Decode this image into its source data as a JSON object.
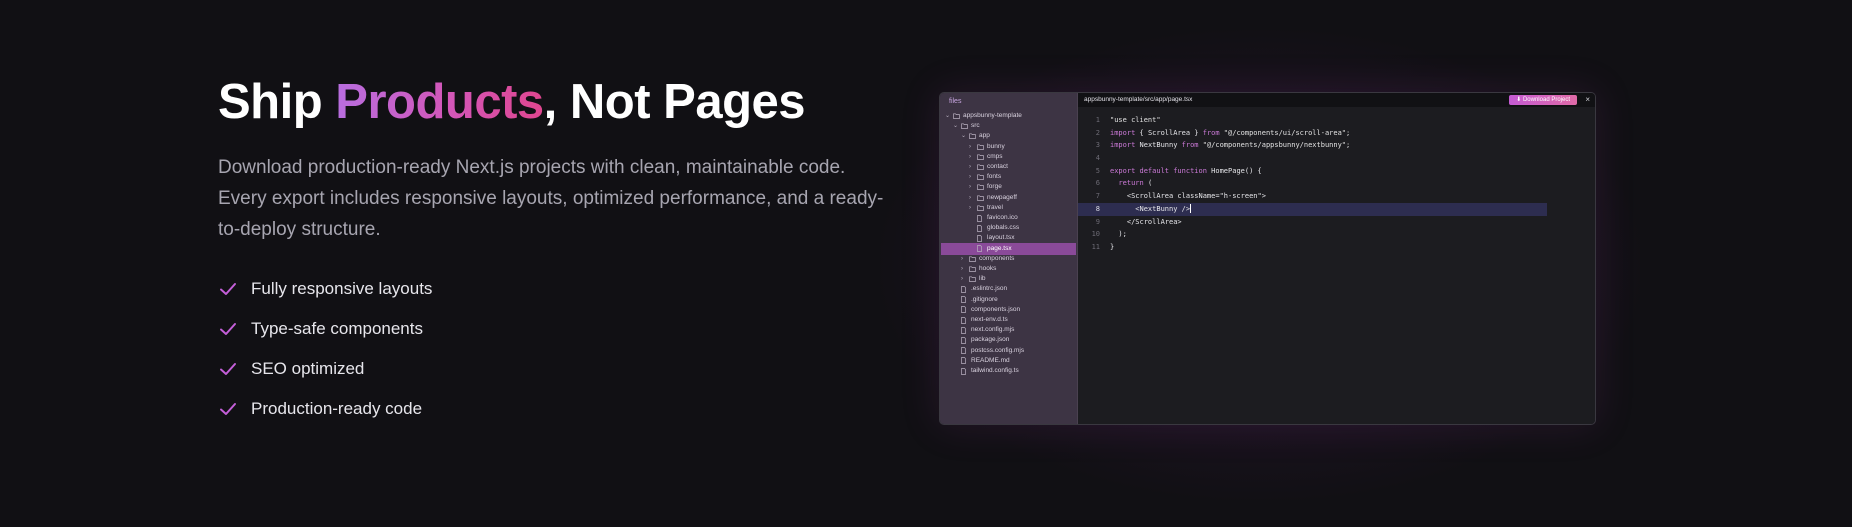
{
  "hero": {
    "title_part1": "Ship ",
    "title_highlight": "Products",
    "title_part2": ", Not Pages",
    "description": "Download production-ready Next.js projects with clean, maintainable code. Every export includes responsive layouts, optimized performance, and a ready-to-deploy structure.",
    "features": [
      "Fully responsive layouts",
      "Type-safe components",
      "SEO optimized",
      "Production-ready code"
    ]
  },
  "colors": {
    "accent_start": "#b86ee0",
    "accent_end": "#e0468f",
    "check": "#c45fd8",
    "sidebar_bg": "#3d3444",
    "active_row": "#8a4a99"
  },
  "editor": {
    "sidebar_header": "files",
    "tree": [
      {
        "label": "appsbunny-template",
        "type": "folder",
        "depth": 0,
        "open": true
      },
      {
        "label": "src",
        "type": "folder",
        "depth": 1,
        "open": true
      },
      {
        "label": "app",
        "type": "folder",
        "depth": 2,
        "open": true
      },
      {
        "label": "bunny",
        "type": "folder",
        "depth": 3,
        "open": false
      },
      {
        "label": "cmps",
        "type": "folder",
        "depth": 3,
        "open": false
      },
      {
        "label": "contact",
        "type": "folder",
        "depth": 3,
        "open": false
      },
      {
        "label": "fonts",
        "type": "folder",
        "depth": 3,
        "open": false
      },
      {
        "label": "forge",
        "type": "folder",
        "depth": 3,
        "open": false
      },
      {
        "label": "newpageff",
        "type": "folder",
        "depth": 3,
        "open": false
      },
      {
        "label": "travel",
        "type": "folder",
        "depth": 3,
        "open": false
      },
      {
        "label": "favicon.ico",
        "type": "file",
        "depth": 3
      },
      {
        "label": "globals.css",
        "type": "file",
        "depth": 3
      },
      {
        "label": "layout.tsx",
        "type": "file",
        "depth": 3
      },
      {
        "label": "page.tsx",
        "type": "file",
        "depth": 3,
        "active": true
      },
      {
        "label": "components",
        "type": "folder",
        "depth": 2,
        "open": false
      },
      {
        "label": "hooks",
        "type": "folder",
        "depth": 2,
        "open": false
      },
      {
        "label": "lib",
        "type": "folder",
        "depth": 2,
        "open": false
      },
      {
        "label": ".eslintrc.json",
        "type": "file",
        "depth": 1
      },
      {
        "label": ".gitignore",
        "type": "file",
        "depth": 1
      },
      {
        "label": "components.json",
        "type": "file",
        "depth": 1
      },
      {
        "label": "next-env.d.ts",
        "type": "file",
        "depth": 1
      },
      {
        "label": "next.config.mjs",
        "type": "file",
        "depth": 1
      },
      {
        "label": "package.json",
        "type": "file",
        "depth": 1
      },
      {
        "label": "postcss.config.mjs",
        "type": "file",
        "depth": 1
      },
      {
        "label": "README.md",
        "type": "file",
        "depth": 1
      },
      {
        "label": "tailwind.config.ts",
        "type": "file",
        "depth": 1
      }
    ],
    "file_path": "appsbunny-template/src/app/page.tsx",
    "download_button": "Download Project",
    "close_icon": "close-icon",
    "highlighted_line": 8,
    "code_lines": [
      [
        {
          "t": "\"use client\"",
          "c": "str"
        }
      ],
      [
        {
          "t": "import",
          "c": "kw"
        },
        {
          "t": " { ScrollArea } ",
          "c": ""
        },
        {
          "t": "from",
          "c": "kw"
        },
        {
          "t": " \"@/components/ui/scroll-area\";",
          "c": "str"
        }
      ],
      [
        {
          "t": "import",
          "c": "kw"
        },
        {
          "t": " NextBunny ",
          "c": ""
        },
        {
          "t": "from",
          "c": "kw"
        },
        {
          "t": " \"@/components/appsbunny/nextbunny\";",
          "c": "str"
        }
      ],
      [],
      [
        {
          "t": "export default function",
          "c": "kw"
        },
        {
          "t": " HomePage() {",
          "c": ""
        }
      ],
      [
        {
          "t": "  ",
          "c": ""
        },
        {
          "t": "return",
          "c": "kw"
        },
        {
          "t": " (",
          "c": ""
        }
      ],
      [
        {
          "t": "    <ScrollArea className=\"h-screen\">",
          "c": ""
        }
      ],
      [
        {
          "t": "      <NextBunny />",
          "c": ""
        }
      ],
      [
        {
          "t": "    </ScrollArea>",
          "c": ""
        }
      ],
      [
        {
          "t": "  );",
          "c": ""
        }
      ],
      [
        {
          "t": "}",
          "c": ""
        }
      ]
    ]
  }
}
